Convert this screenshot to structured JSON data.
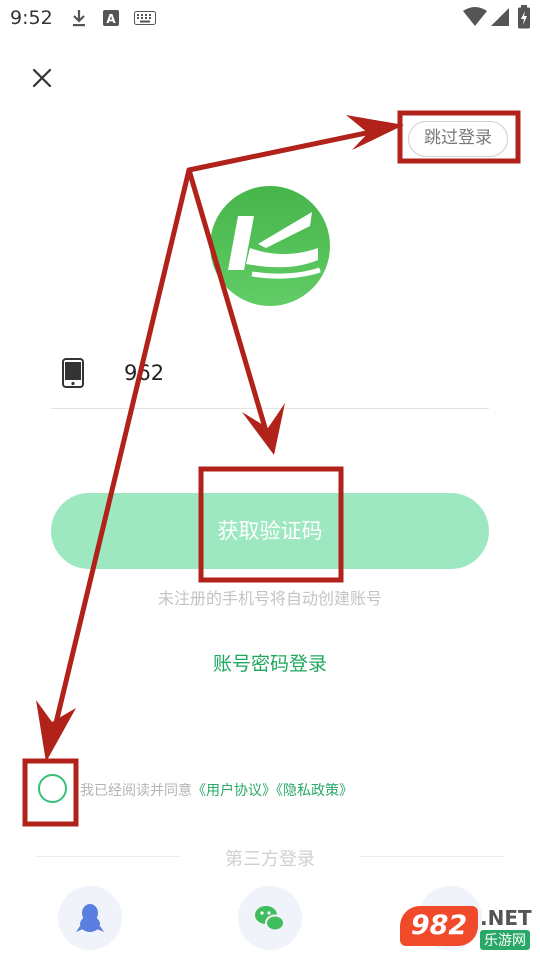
{
  "status_bar": {
    "time": "9:52",
    "icons": [
      "download-icon",
      "text-a-icon",
      "keyboard-icon",
      "wifi-icon",
      "signal-icon",
      "battery-charging-icon"
    ]
  },
  "header": {
    "close_icon": "close-icon",
    "skip_label": "跳过登录"
  },
  "logo": {
    "icon": "kc-app-logo-icon",
    "color": "#4fc25a"
  },
  "phone_field": {
    "icon": "phone-icon",
    "value": "962"
  },
  "get_code_button": {
    "label": "获取验证码",
    "color": "#9ee8c1"
  },
  "hint": "未注册的手机号将自动创建账号",
  "password_login": {
    "label": "账号密码登录",
    "color": "#1ea85c"
  },
  "agreement": {
    "checked": false,
    "prefix": "我已经阅读并同意",
    "terms_link": "《用户协议》",
    "privacy_link": "《隐私政策》"
  },
  "third_party": {
    "label": "第三方登录",
    "providers": [
      "qq-icon",
      "wechat-icon",
      "weibo-icon"
    ]
  },
  "watermark": {
    "number": "982",
    "suffix": ".NET",
    "site": "乐游网"
  },
  "annotation_color": "#b0221a"
}
